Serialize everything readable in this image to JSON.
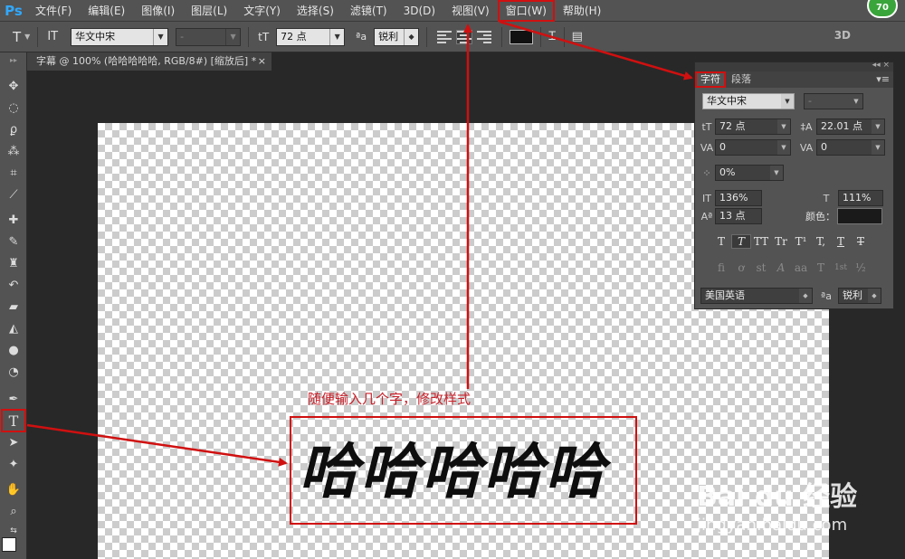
{
  "app": {
    "logo": "Ps",
    "badge": "70"
  },
  "menu": [
    "文件(F)",
    "编辑(E)",
    "图像(I)",
    "图层(L)",
    "文字(Y)",
    "选择(S)",
    "滤镜(T)",
    "3D(D)",
    "视图(V)",
    "窗口(W)",
    "帮助(H)"
  ],
  "options": {
    "tool_icon": "T",
    "orient_icon": "IT",
    "font_family": "华文中宋",
    "font_style": "-",
    "size_icon": "tT",
    "font_size": "72 点",
    "aa_icon": "ªa",
    "antialias": "锐利",
    "threed": "3D",
    "text_color": "#111111"
  },
  "document": {
    "tab_title": "字幕 @ 100% (哈哈哈哈哈, RGB/8#) [缩放后] *",
    "close": "×"
  },
  "canvas": {
    "annotation": "随便输入几个字，修改样式",
    "text": "哈哈哈哈哈"
  },
  "char_panel": {
    "tab_character": "字符",
    "tab_paragraph": "段落",
    "menu": "▾≡",
    "collapse": "◂◂ ×",
    "font_family": "华文中宋",
    "font_style": "-",
    "font_size": "72 点",
    "leading": "22.01 点",
    "kerning": "0",
    "tracking": "0",
    "tsume": "0%",
    "vertical_scale": "136%",
    "horizontal_scale": "111%",
    "baseline_shift": "13 点",
    "color_label": "颜色：",
    "color_value": "#1a1a1a",
    "styles_row1": [
      "T",
      "T",
      "TT",
      "Tr",
      "T¹",
      "T,",
      "T",
      "T"
    ],
    "styles_row2": [
      "fi",
      "ơ",
      "st",
      "A",
      "aa",
      "T",
      "1st",
      "½"
    ],
    "language": "美国英语",
    "aa_icon": "ªa",
    "antialias": "锐利"
  },
  "watermark": {
    "title": "Bai du 经验",
    "sub": "jingyan.baidu.com"
  }
}
